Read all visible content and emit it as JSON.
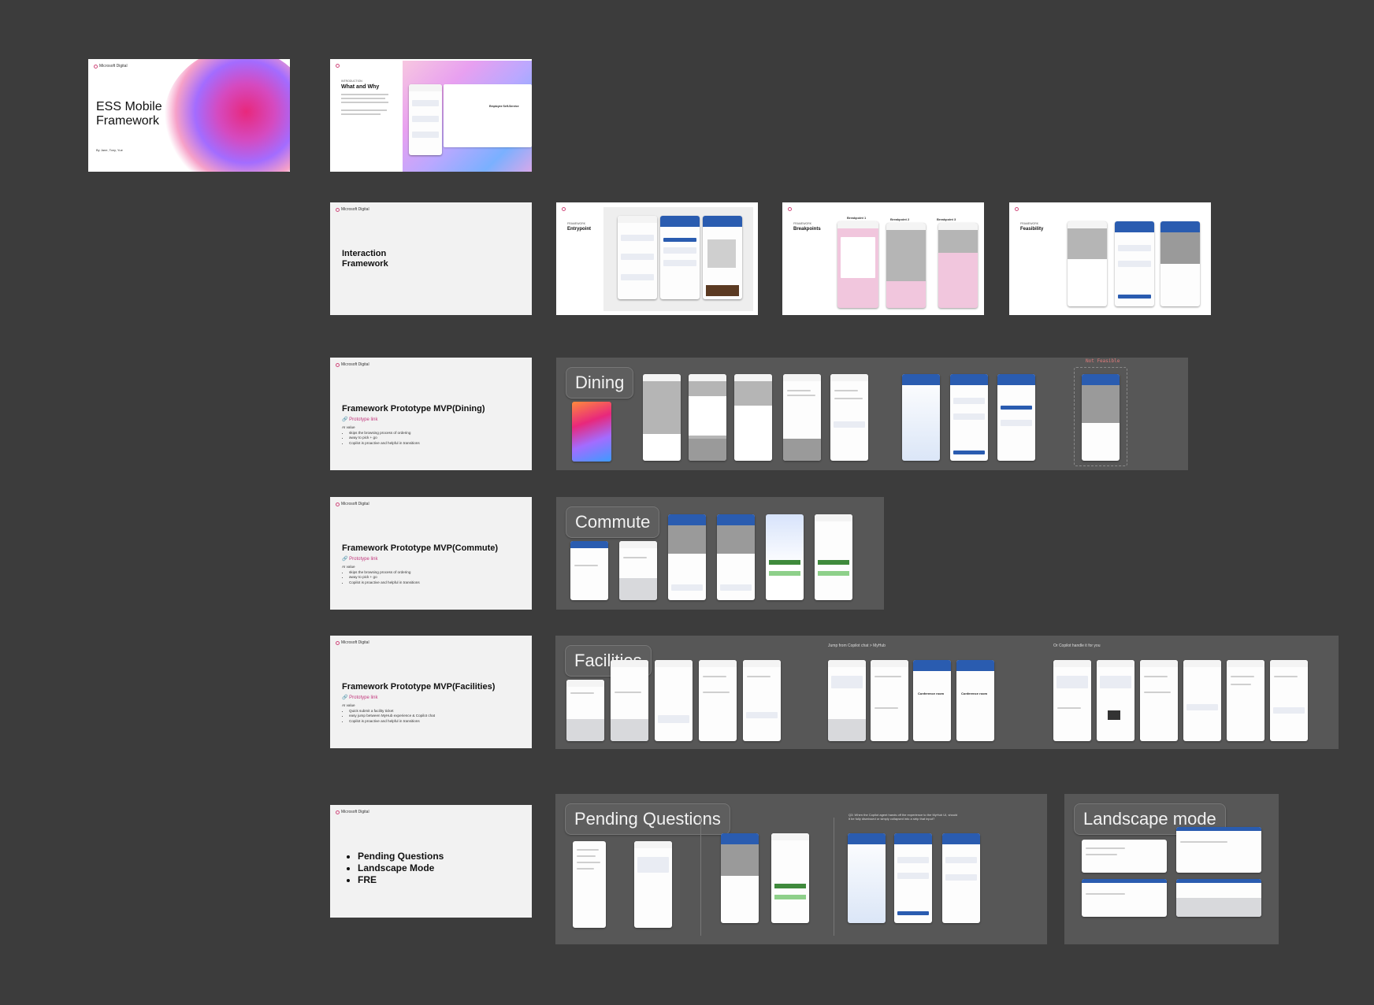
{
  "brand": {
    "logo_text": "Microsoft Digital",
    "accent": "#c2377c",
    "section_bg": "#575757",
    "canvas_bg": "#3c3c3c"
  },
  "slides": {
    "cover": {
      "title_line1": "ESS Mobile",
      "title_line2": "Framework",
      "byline": "By Jane, Tony, Yue"
    },
    "what_why": {
      "kicker": "INTRODUCTION",
      "title": "What and Why",
      "app_label": "Employee Self-Service"
    },
    "interaction": {
      "title_line1": "Interaction",
      "title_line2": "Framework"
    },
    "entrypoint": {
      "kicker": "FRAMEWORK",
      "title": "Entrypoint"
    },
    "breakpoints": {
      "kicker": "FRAMEWORK",
      "title": "Breakpoints",
      "bp1": "Breakpoint 1",
      "bp2": "Breakpoint 2",
      "bp3": "Breakpoint 3"
    },
    "feasibility": {
      "kicker": "FRAMEWORK",
      "title": "Feasibility"
    },
    "dining": {
      "title": "Framework Prototype MVP(Dining)",
      "link": "🔗 Prototype link",
      "ai_value": "AI value",
      "bullets": [
        "skips the browsing process of ordering",
        "away to pick + go",
        "Copilot is proactive and helpful in transitions"
      ]
    },
    "commute": {
      "title": "Framework Prototype MVP(Commute)",
      "link": "🔗 Prototype link",
      "ai_value": "AI value",
      "bullets": [
        "skips the browsing process of ordering",
        "away to pick + go",
        "Copilot is proactive and helpful in transitions"
      ]
    },
    "facilities": {
      "title": "Framework Prototype MVP(Facilities)",
      "link": "🔗 Prototype link",
      "ai_value": "AI value",
      "bullets": [
        "Quick submit a facility ticket",
        "easy jump between MyHub experience & Copilot chat",
        "Copilot is proactive and helpful in transitions"
      ]
    },
    "pending": {
      "bullets": [
        "Pending Questions",
        "Landscape Mode",
        "FRE"
      ]
    }
  },
  "sections": {
    "dining": {
      "label": "Dining",
      "not_feasible": "Not Feasible"
    },
    "commute": {
      "label": "Commute"
    },
    "facilities": {
      "label": "Facilities",
      "caption_jump": "Jump from Copilot chat > MyHub",
      "caption_copilot": "Or Copilot handle it for you",
      "conf_title": "Conference room"
    },
    "pending": {
      "label": "Pending Questions",
      "q3": "Q3: When the Copilot agent hands off the experience to the MyHub UI, should it be fully dismissed or simply collapsed into a strip that input?"
    },
    "landscape": {
      "label": "Landscape mode"
    }
  }
}
